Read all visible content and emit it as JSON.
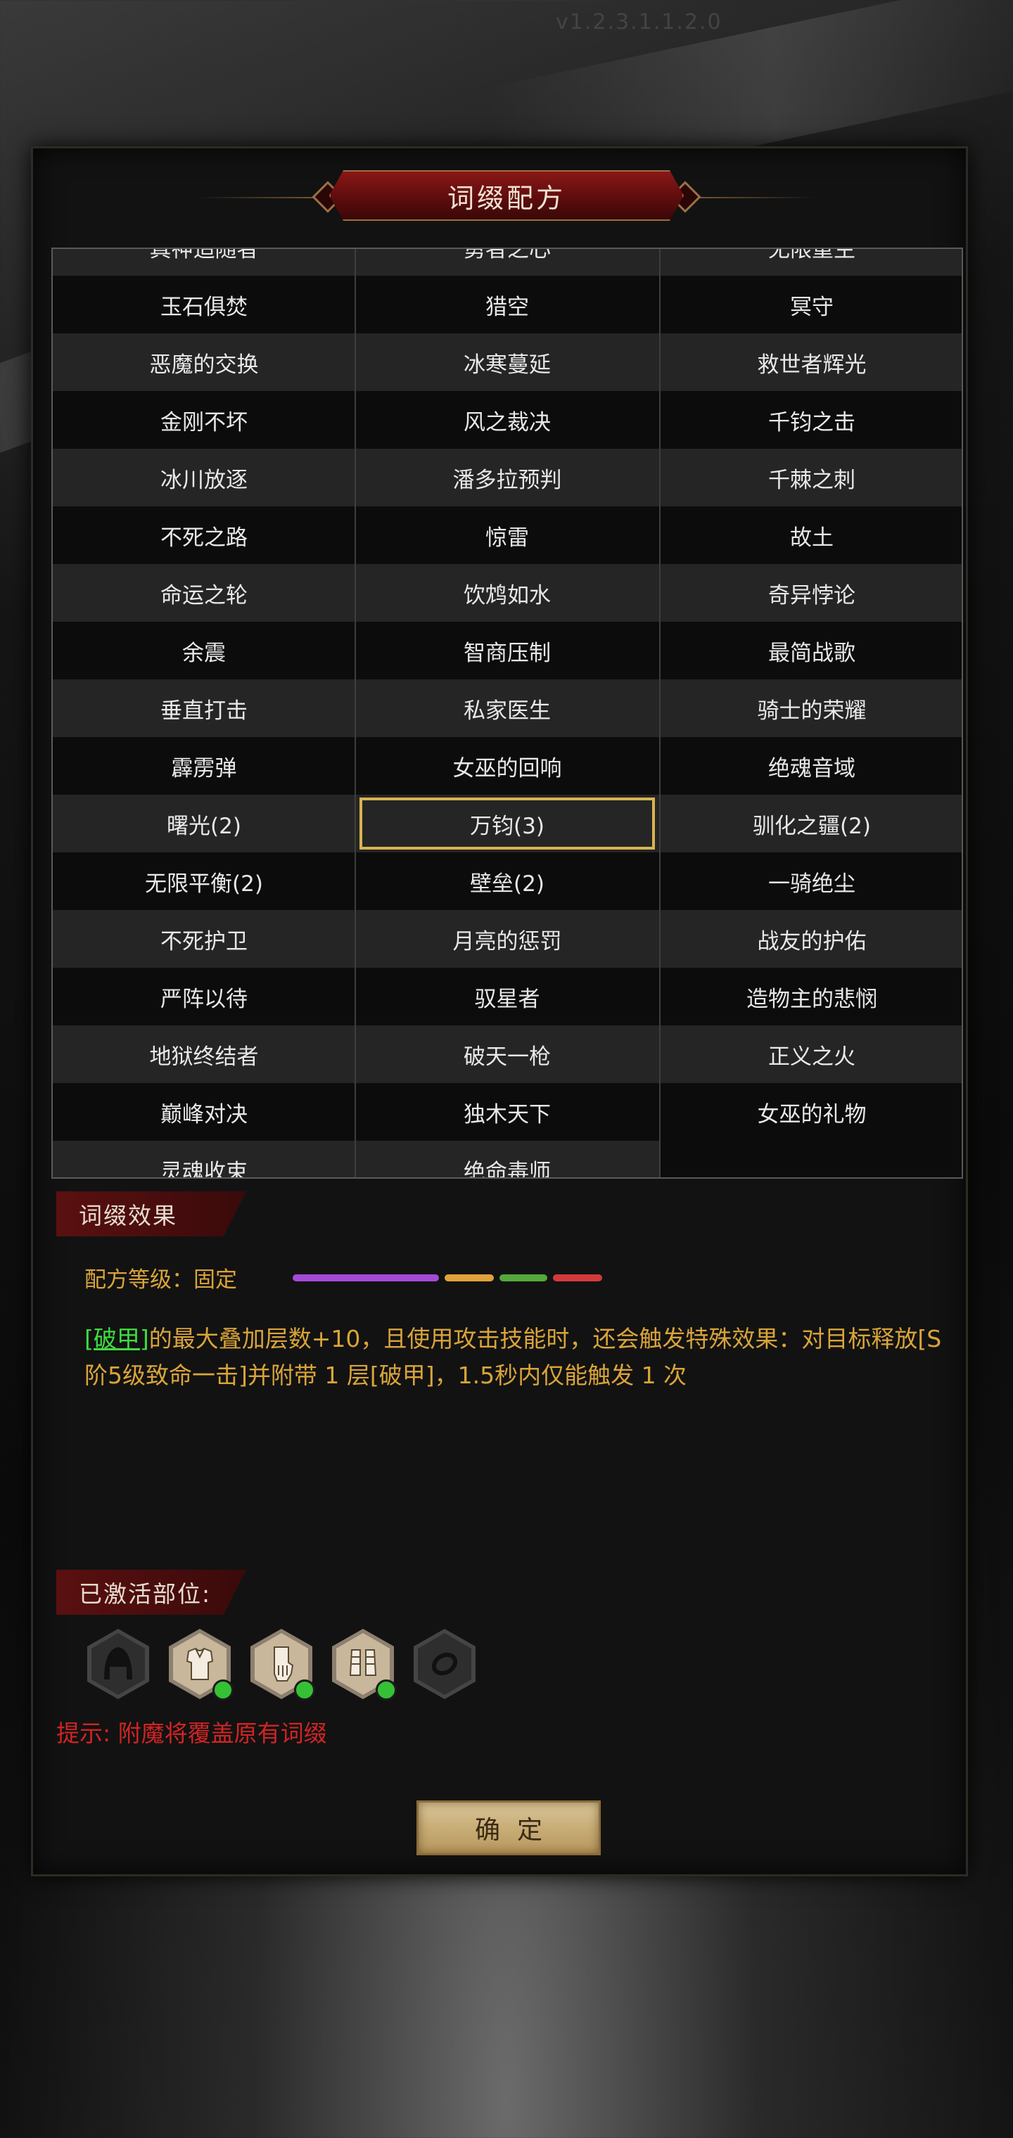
{
  "version": "v1.2.3.1.1.2.0",
  "title": "词缀配方",
  "columns": [
    [
      "真神追随者",
      "玉石俱焚",
      "恶魔的交换",
      "金刚不坏",
      "冰川放逐",
      "不死之路",
      "命运之轮",
      "余震",
      "垂直打击",
      "霹雳弹",
      "曙光(2)",
      "无限平衡(2)",
      "不死护卫",
      "严阵以待",
      "地狱终结者",
      "巅峰对决",
      "灵魂收束"
    ],
    [
      "勇者之心",
      "猎空",
      "冰寒蔓延",
      "风之裁决",
      "潘多拉预判",
      "惊雷",
      "饮鸩如水",
      "智商压制",
      "私家医生",
      "女巫的回响",
      "万钧(3)",
      "壁垒(2)",
      "月亮的惩罚",
      "驭星者",
      "破天一枪",
      "独木天下",
      "绝命毒师"
    ],
    [
      "无限重生",
      "冥守",
      "救世者辉光",
      "千钧之击",
      "千棘之刺",
      "故土",
      "奇异悖论",
      "最简战歌",
      "骑士的荣耀",
      "绝魂音域",
      "驯化之疆(2)",
      "一骑绝尘",
      "战友的护佑",
      "造物主的悲悯",
      "正义之火",
      "女巫的礼物"
    ]
  ],
  "selected": "万钧(3)",
  "effect_section": "词缀效果",
  "grade_label": "配方等级：固定",
  "grade_colors": [
    "#a54ad6",
    "#e0a23a",
    "#55a83a",
    "#d23a3a"
  ],
  "desc_tag": "[破甲]",
  "desc_text": "的最大叠加层数+10，且使用攻击技能时，还会触发特殊效果：对目标释放[S阶5级致命一击]并附带 1 层[破甲]，1.5秒内仅能触发 1 次",
  "activated_section": "已激活部位:",
  "slots": [
    {
      "icon": "helmet-icon",
      "active": false
    },
    {
      "icon": "armor-icon",
      "active": true
    },
    {
      "icon": "glove-icon",
      "active": true
    },
    {
      "icon": "boots-icon",
      "active": true
    },
    {
      "icon": "ring-icon",
      "active": false
    }
  ],
  "hint": "提示: 附魔将覆盖原有词缀",
  "confirm_label": "确定"
}
